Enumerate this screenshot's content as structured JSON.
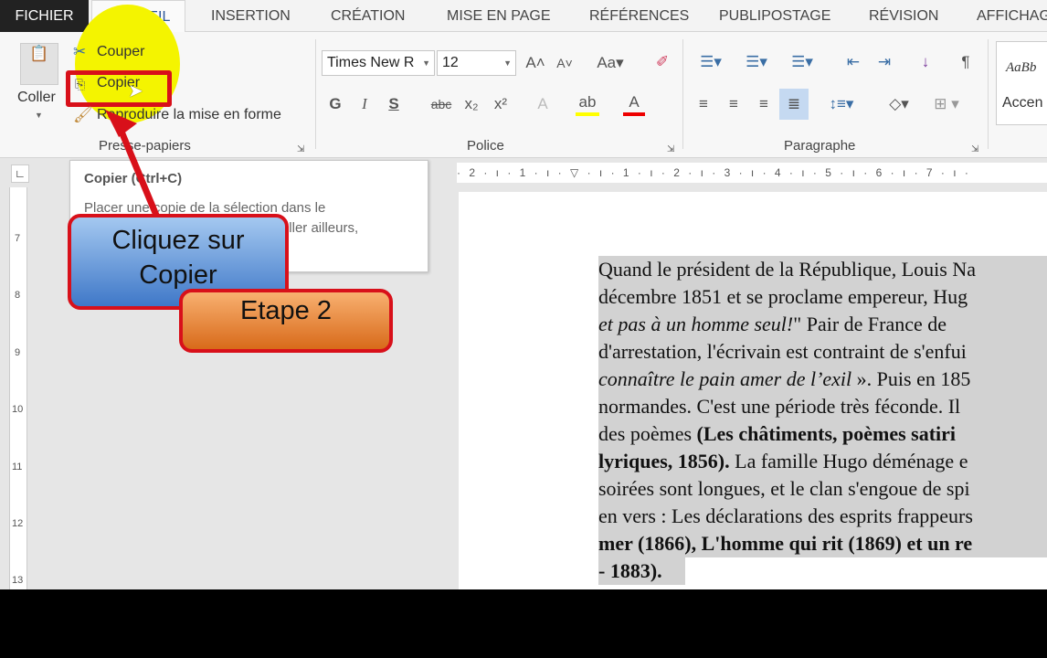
{
  "tabs": [
    "FICHIER",
    "ACCUEIL",
    "INSERTION",
    "CRÉATION",
    "MISE EN PAGE",
    "RÉFÉRENCES",
    "PUBLIPOSTAGE",
    "RÉVISION",
    "AFFICHAGE"
  ],
  "clipboard": {
    "paste": "Coller",
    "cut": "Couper",
    "copy": "Copier",
    "format_painter": "Reproduire la mise en forme",
    "group": "Presse-papiers"
  },
  "font": {
    "name": "Times New R",
    "size": "12",
    "group": "Police",
    "bold": "G",
    "italic": "I",
    "underline": "S",
    "strike": "abc",
    "sub": "x₂",
    "sup": "x²"
  },
  "paragraph": {
    "group": "Paragraphe"
  },
  "styles": {
    "preview": "AaBb",
    "name": "Accen"
  },
  "tooltip": {
    "title": "Copier (Ctrl+C)",
    "line1": "Placer une copie de la sélection dans le",
    "line2": "Presse-papiers pour pouvoir la coller ailleurs,"
  },
  "callouts": {
    "click": "Cliquez sur Copier",
    "step": "Etape 2"
  },
  "ruler": {
    "h": "· 2 · ı · 1 · ı · ▽ · ı · 1 · ı · 2 · ı · 3 · ı · 4 · ı · 5 · ı · 6 · ı · 7 · ı ·",
    "v": [
      "7",
      "8",
      "9",
      "10",
      "11",
      "12",
      "13"
    ]
  },
  "document": {
    "lines": [
      {
        "parts": [
          {
            "t": "Quand le président de la République, Louis Na",
            "s": "n"
          }
        ]
      },
      {
        "parts": [
          {
            "t": "décembre 1851 et se proclame empereur, Hug",
            "s": "n"
          }
        ]
      },
      {
        "parts": [
          {
            "t": "et pas à un homme seul!",
            "s": "i"
          },
          {
            "t": "\" Pair de France de",
            "s": "n"
          }
        ]
      },
      {
        "parts": [
          {
            "t": "d'arrestation, l'écrivain est contraint de s'enfui",
            "s": "n"
          }
        ]
      },
      {
        "parts": [
          {
            "t": "connaître le pain amer de l’exil",
            "s": "i"
          },
          {
            "t": " ». Puis en 185",
            "s": "n"
          }
        ]
      },
      {
        "parts": [
          {
            "t": "normandes. C'est une période très féconde. Il",
            "s": "n"
          }
        ]
      },
      {
        "parts": [
          {
            "t": "des poèmes ",
            "s": "n"
          },
          {
            "t": "(Les châtiments, poèmes satiri",
            "s": "b"
          }
        ]
      },
      {
        "parts": [
          {
            "t": "lyriques, 1856).",
            "s": "b"
          },
          {
            "t": " La famille Hugo déménage e",
            "s": "n"
          }
        ]
      },
      {
        "parts": [
          {
            "t": "soirées sont longues, et le clan s'engoue de spi",
            "s": "n"
          }
        ]
      },
      {
        "parts": [
          {
            "t": "en vers : Les déclarations des esprits frappeurs",
            "s": "n"
          }
        ]
      },
      {
        "parts": [
          {
            "t": "mer (1866), L'homme qui rit (1869) et un re",
            "s": "b"
          }
        ]
      },
      {
        "parts": [
          {
            "t": "- 1883).",
            "s": "b"
          }
        ]
      }
    ]
  }
}
